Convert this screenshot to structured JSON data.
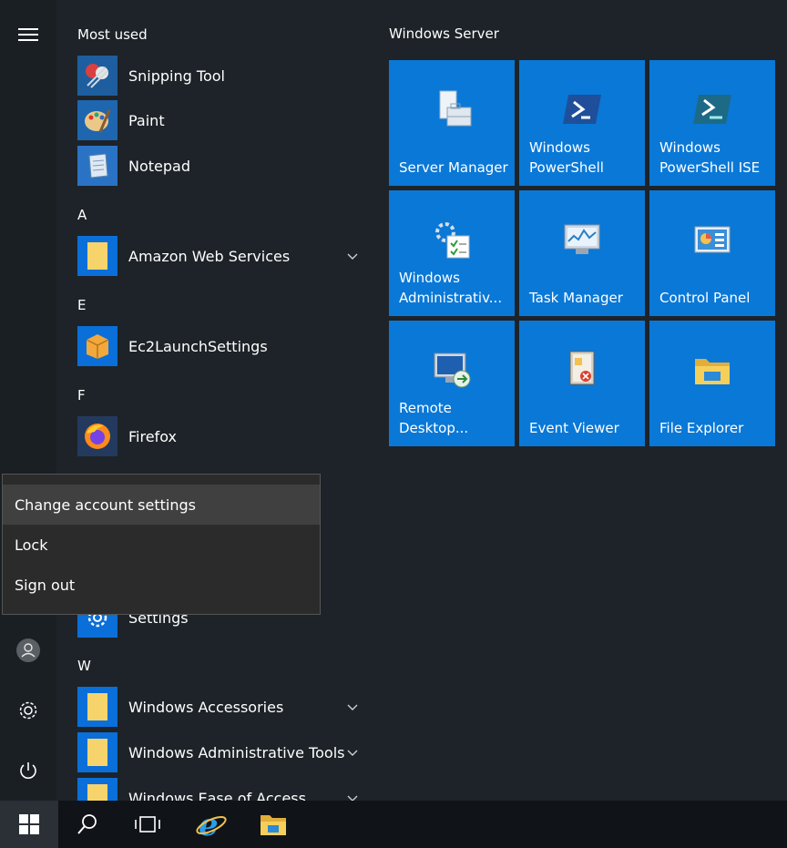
{
  "rail": {
    "menu_icon": "hamburger-icon",
    "user_icon": "user-icon",
    "settings_icon": "gear-icon",
    "power_icon": "power-icon"
  },
  "applist": {
    "most_used_title": "Most used",
    "most_used": [
      {
        "label": "Snipping Tool",
        "icon": "snipping-tool-icon"
      },
      {
        "label": "Paint",
        "icon": "paint-icon"
      },
      {
        "label": "Notepad",
        "icon": "notepad-icon"
      }
    ],
    "group_a": {
      "letter": "A",
      "items": [
        {
          "label": "Amazon Web Services",
          "icon": "folder-icon"
        }
      ]
    },
    "group_e": {
      "letter": "E",
      "items": [
        {
          "label": "Ec2LaunchSettings",
          "icon": "ec2-icon"
        }
      ]
    },
    "group_f": {
      "letter": "F",
      "items": [
        {
          "label": "Firefox",
          "icon": "firefox-icon"
        }
      ]
    },
    "settings_label": "Settings",
    "group_w": {
      "letter": "W",
      "items": [
        {
          "label": "Windows Accessories",
          "icon": "folder-icon"
        },
        {
          "label": "Windows Administrative Tools",
          "icon": "folder-icon"
        },
        {
          "label": "Windows Ease of Access",
          "icon": "folder-icon"
        }
      ]
    }
  },
  "account_menu": {
    "items": [
      "Change account settings",
      "Lock",
      "Sign out"
    ]
  },
  "tiles": {
    "group_title": "Windows Server",
    "items": [
      {
        "label": "Server Manager",
        "icon": "server-manager-icon"
      },
      {
        "label": "Windows\nPowerShell",
        "icon": "powershell-icon"
      },
      {
        "label": "Windows\nPowerShell ISE",
        "icon": "powershell-ise-icon"
      },
      {
        "label": "Windows\nAdministrativ...",
        "icon": "admin-tools-icon"
      },
      {
        "label": "Task Manager",
        "icon": "task-manager-icon"
      },
      {
        "label": "Control Panel",
        "icon": "control-panel-icon"
      },
      {
        "label": "Remote\nDesktop...",
        "icon": "remote-desktop-icon"
      },
      {
        "label": "Event Viewer",
        "icon": "event-viewer-icon"
      },
      {
        "label": "File Explorer",
        "icon": "file-explorer-icon"
      }
    ]
  },
  "taskbar": {
    "items": [
      "start-icon",
      "search-icon",
      "task-view-icon",
      "internet-explorer-icon",
      "file-explorer-icon"
    ]
  },
  "colors": {
    "tile": "#0a78d7",
    "folder_tile": "#0a6fd8",
    "menu_bg": "#1d2328",
    "taskbar_bg": "#101317"
  }
}
